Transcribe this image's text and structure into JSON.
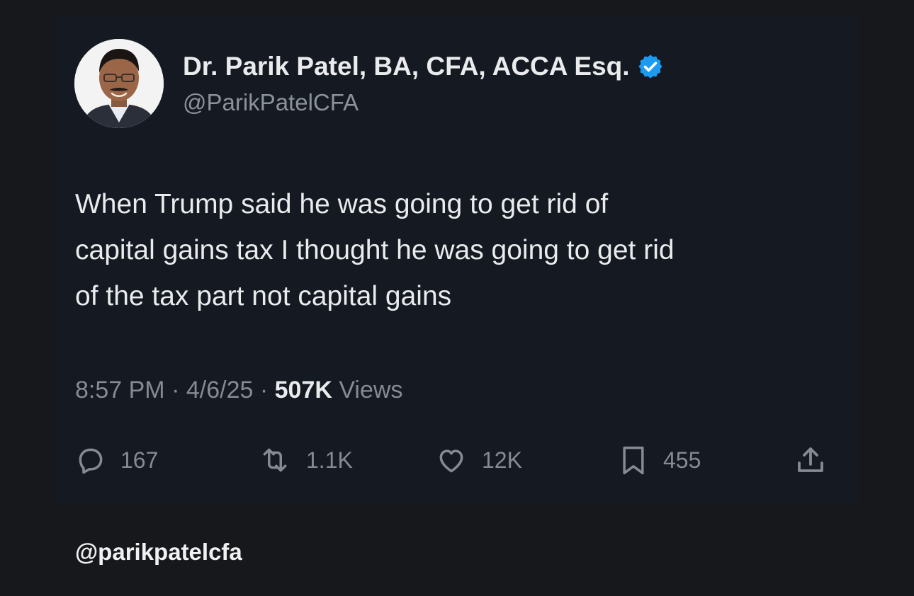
{
  "tweet": {
    "author_name": "Dr. Parik Patel, BA, CFA, ACCA Esq.",
    "author_handle": "@ParikPatelCFA",
    "verified": true,
    "text_lines": [
      "When Trump said he was going to get rid of",
      "capital gains tax I thought he was going to get rid",
      "of the tax part not capital gains"
    ],
    "time": "8:57 PM",
    "date": "4/6/25",
    "separator": "·",
    "views_count": "507K",
    "views_label": "Views"
  },
  "actions": {
    "replies": {
      "icon": "reply-icon",
      "count": "167"
    },
    "reposts": {
      "icon": "repost-icon",
      "count": "1.1K"
    },
    "likes": {
      "icon": "heart-icon",
      "count": "12K"
    },
    "bookmarks": {
      "icon": "bookmark-icon",
      "count": "455"
    },
    "share": {
      "icon": "share-icon"
    }
  },
  "footer": {
    "watermark_handle": "@parikpatelcfa"
  },
  "colors": {
    "page_background": "#17181b",
    "card_background": "#151a22",
    "primary_text": "#e9ebed",
    "secondary_text": "#858b92",
    "verified_blue": "#1d9bf0"
  }
}
